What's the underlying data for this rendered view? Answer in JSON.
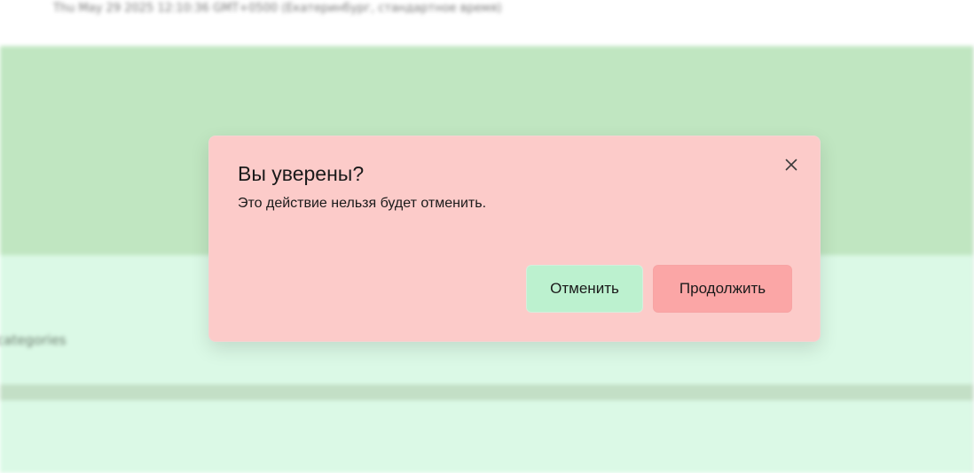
{
  "background": {
    "date_text": "Thu May 29 2025 12:10:36 GMT+0500 (Екатеринбург, стандартное время)",
    "categories_text": "categories"
  },
  "dialog": {
    "title": "Вы уверены?",
    "description": "Это действие нельзя будет отменить.",
    "close_icon": "close-icon",
    "cancel_label": "Отменить",
    "continue_label": "Продолжить"
  },
  "colors": {
    "dialog_bg": "#fccbc9",
    "cancel_bg": "#bcf1cf",
    "continue_bg": "#fba6a6",
    "backdrop_band": "#c0e6c1",
    "backdrop_lower": "#dbf9e6"
  }
}
